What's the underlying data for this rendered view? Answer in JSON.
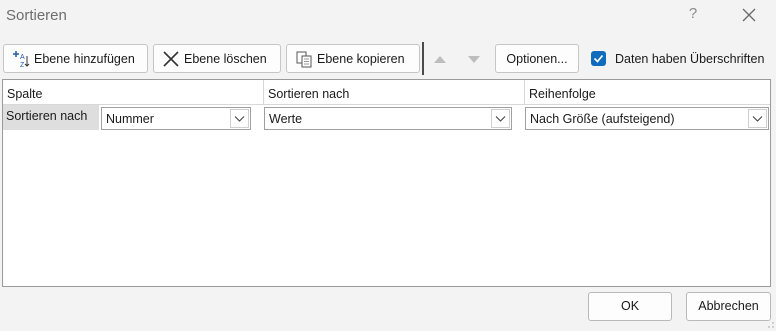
{
  "window": {
    "title": "Sortieren",
    "help": "?"
  },
  "toolbar": {
    "add_level": "Ebene hinzufügen",
    "delete_level": "Ebene löschen",
    "copy_level": "Ebene kopieren",
    "options": "Optionen...",
    "headers_checkbox": {
      "label": "Daten haben Überschriften",
      "checked": true
    }
  },
  "grid": {
    "columns": [
      "Spalte",
      "Sortieren nach",
      "Reihenfolge"
    ],
    "rows": [
      {
        "label": "Sortieren nach",
        "column": "Nummer",
        "sort_on": "Werte",
        "order": "Nach Größe (aufsteigend)"
      }
    ]
  },
  "footer": {
    "ok": "OK",
    "cancel": "Abbrechen"
  },
  "colors": {
    "accent": "#0f6cbd",
    "window_bg": "#f3f3f3",
    "grid_bg": "#ffffff"
  }
}
